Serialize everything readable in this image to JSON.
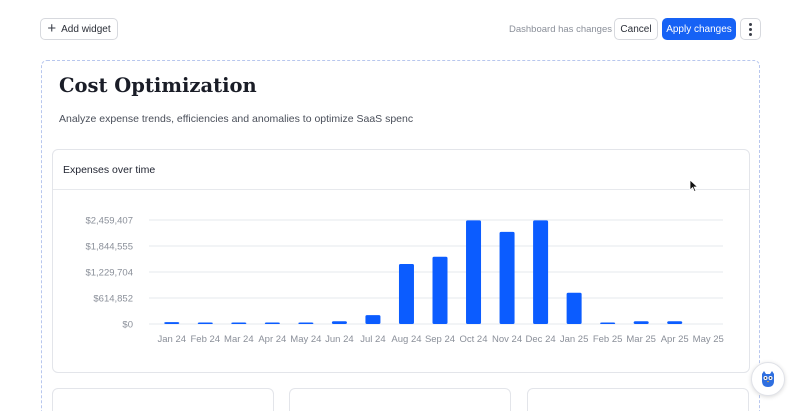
{
  "toolbar": {
    "add_widget_label": "Add widget",
    "status_text": "Dashboard has changes",
    "cancel_label": "Cancel",
    "apply_label": "Apply changes"
  },
  "page": {
    "title": "Cost Optimization",
    "subtitle": "Analyze expense trends, efficiencies and anomalies to optimize SaaS spenc"
  },
  "widget": {
    "title": "Expenses over time"
  },
  "icons": {
    "add": "plus-icon",
    "more": "kebab-menu-icon",
    "assistant": "owl-mascot-icon",
    "pointer": "mouse-cursor-icon"
  },
  "colors": {
    "accent": "#1662f5",
    "bar": "#0b5cff"
  },
  "chart_data": {
    "type": "bar",
    "title": "Expenses over time",
    "categories": [
      "Jan 24",
      "Feb 24",
      "Mar 24",
      "Apr 24",
      "May 24",
      "Jun 24",
      "Jul 24",
      "Aug 24",
      "Sep 24",
      "Oct 24",
      "Nov 24",
      "Dec 24",
      "Jan 25",
      "Feb 25",
      "Mar 25",
      "Apr 25",
      "May 25"
    ],
    "values": [
      45000,
      20000,
      12000,
      15000,
      25000,
      65000,
      210000,
      1420000,
      1590000,
      2450000,
      2180000,
      2450000,
      740000,
      5000,
      65000,
      65000,
      0
    ],
    "yticks": [
      "$0",
      "$614,852",
      "$1,229,704",
      "$1,844,555",
      "$2,459,407"
    ],
    "ytick_values": [
      0,
      614852,
      1229704,
      1844555,
      2459407
    ],
    "ylim": [
      0,
      2459407
    ],
    "grid": true,
    "legend": false
  }
}
